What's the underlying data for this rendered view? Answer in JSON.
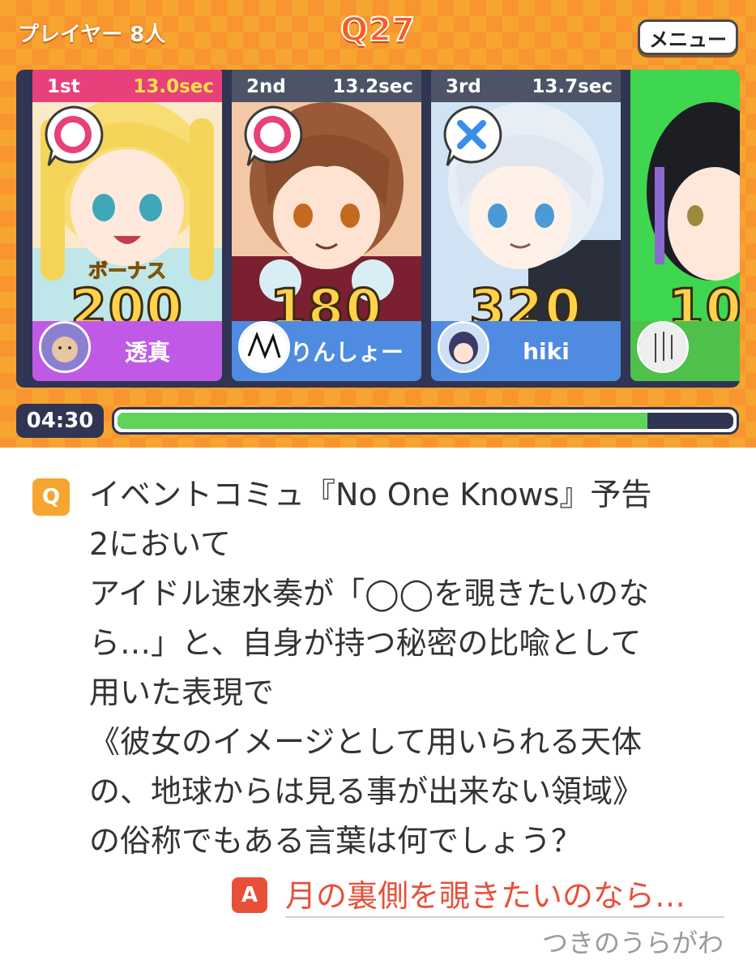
{
  "header": {
    "player_count": "プレイヤー 8人",
    "question_number": "Q27",
    "menu_label": "メニュー"
  },
  "players": [
    {
      "rank": "1st",
      "time": "13.0sec",
      "mark": "correct",
      "bonus": "ボーナス",
      "score": "200",
      "name": "透真",
      "namebar_color": "#c05ae6",
      "portrait_color": "#f5e39a"
    },
    {
      "rank": "2nd",
      "time": "13.2sec",
      "mark": "correct",
      "score": "180",
      "name": "りんしょー",
      "namebar_color": "#4f8be0",
      "portrait_color": "#a86a45"
    },
    {
      "rank": "3rd",
      "time": "13.7sec",
      "mark": "wrong",
      "score": "320",
      "name": "hiki",
      "namebar_color": "#4f8be0",
      "portrait_color": "#cfe0f2"
    },
    {
      "score": "10",
      "namebar_color": "#4fc04a",
      "portrait_color": "#3fd650"
    }
  ],
  "timer": {
    "remaining": "04:30",
    "progress": 0.86
  },
  "question": {
    "badge": "Q",
    "lines": [
      "イベントコミュ『No One Knows』予告",
      "2において",
      "アイドル速水奏が「◯◯を覗きたいのな",
      "ら…」と、自身が持つ秘密の比喩として",
      "用いた表現で",
      "《彼女のイメージとして用いられる天体",
      "の、地球からは見る事が出来ない領域》",
      "の俗称でもある言葉は何でしょう？"
    ]
  },
  "answer": {
    "badge": "A",
    "text": "月の裏側を覗きたいのなら…",
    "reading": "つきのうらがわ"
  },
  "colors": {
    "orange": "#f6a531",
    "navy": "#2f3552",
    "correct": "#e8407a",
    "wrong": "#3b8ee8",
    "answer_red": "#e8503a"
  }
}
